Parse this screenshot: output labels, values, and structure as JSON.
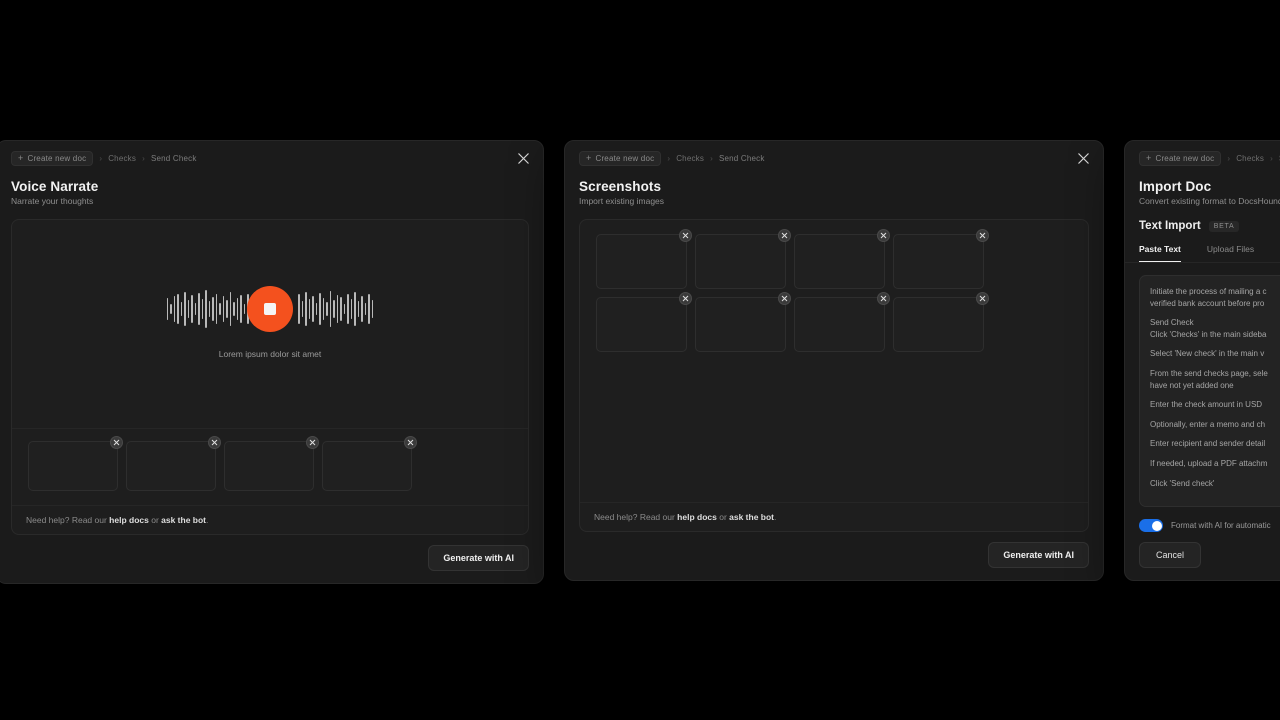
{
  "theme": {
    "page_background": "#000000",
    "panel_background": "#1b1b1b",
    "accent_record": "#f4511e",
    "accent_toggle": "#1a6fe8"
  },
  "breadcrumb": {
    "new_doc": "Create new doc",
    "plus": "+",
    "separator": "›",
    "section": "Checks",
    "current": "Send Check"
  },
  "common": {
    "help_prefix": "Need help? Read our ",
    "help_docs": "help docs",
    "help_middle": " or ",
    "help_bot": "ask the bot",
    "help_suffix": ".",
    "generate_button": "Generate with AI",
    "close_icon": "close-icon",
    "remove_icon": "remove-icon"
  },
  "panels": [
    {
      "id": "voice-narrate",
      "title": "Voice Narrate",
      "subtitle": "Narrate your thoughts",
      "record_caption": "Lorem ipsum dolor sit amet",
      "record_state": "recording",
      "thumbnail_count": 4
    },
    {
      "id": "screenshots",
      "title": "Screenshots",
      "subtitle": "Import existing images",
      "thumbnail_count": 8
    },
    {
      "id": "import-doc",
      "title": "Import Doc",
      "subtitle": "Convert existing format to DocsHound",
      "section_title": "Text Import",
      "badge": "BETA",
      "tabs": [
        {
          "label": "Paste Text",
          "active": true
        },
        {
          "label": "Upload Files",
          "active": false
        }
      ],
      "text_lines": [
        "Initiate the process of mailing a c",
        "verified bank account before pro",
        "",
        "Send Check",
        "Click 'Checks' in the main sideba",
        "",
        "Select 'New check' in the main v",
        "",
        "From the send checks page, sele",
        "have not yet added one",
        "",
        "Enter the check amount in USD",
        "",
        "Optionally, enter a memo and ch",
        "",
        "Enter recipient and sender detail",
        "",
        "If needed, upload a PDF attachm",
        "",
        "Click 'Send check'"
      ],
      "toggle_label": "Format with AI for automatic",
      "toggle_on": true,
      "cancel_button": "Cancel"
    }
  ]
}
